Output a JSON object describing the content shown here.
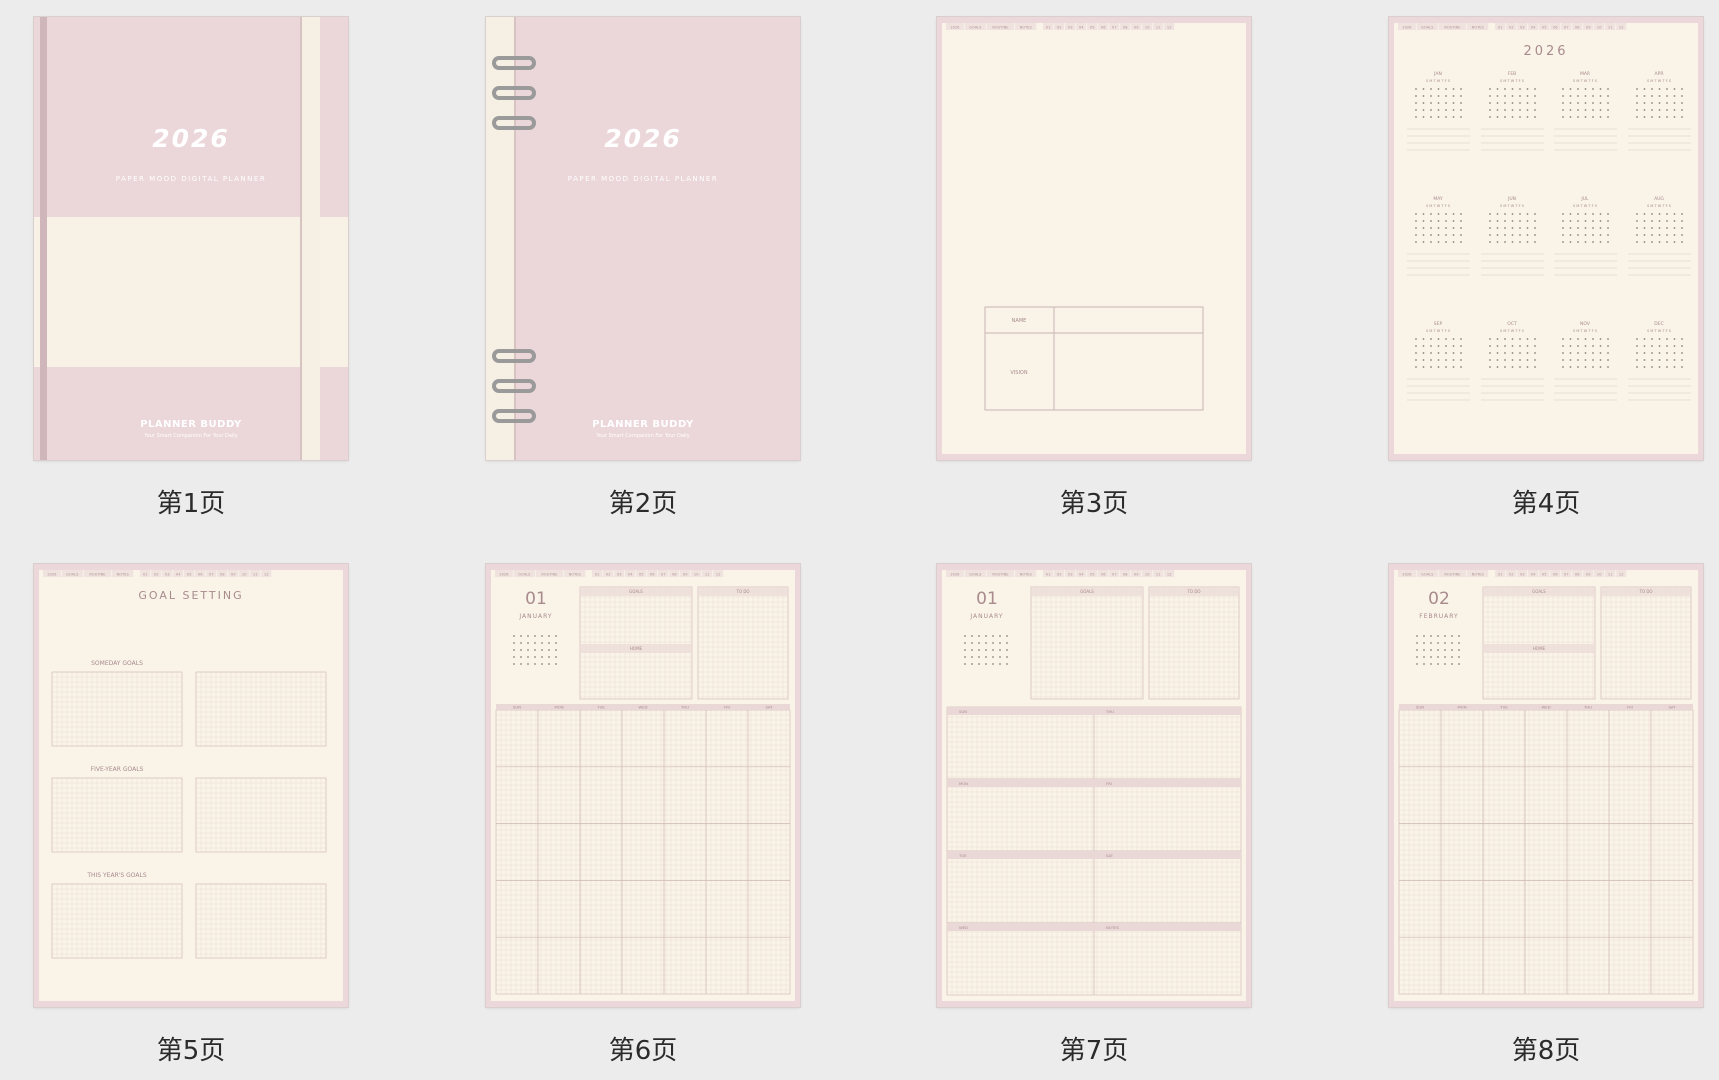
{
  "cover": {
    "year": "2026",
    "subtitle": "PAPER MOOD DIGITAL PLANNER",
    "brand": "PLANNER BUDDY",
    "tagline": "Your Smart Companion For Your Daily"
  },
  "tabs": [
    "2026",
    "GOALS",
    "ROUTINE",
    "NOTES",
    "01",
    "02",
    "03",
    "04",
    "05",
    "06",
    "07",
    "08",
    "09",
    "10",
    "11",
    "12"
  ],
  "name_page": {
    "name_label": "NAME",
    "vision_label": "VISION"
  },
  "year_page": {
    "year": "2026",
    "months": [
      "JAN",
      "FEB",
      "MAR",
      "APR",
      "MAY",
      "JUN",
      "JUL",
      "AUG",
      "SEP",
      "OCT",
      "NOV",
      "DEC"
    ],
    "weekday_letters": "S M T W T F S"
  },
  "goal_page": {
    "title": "GOAL SETTING",
    "sections": [
      "SOMEDAY GOALS",
      "FIVE-YEAR GOALS",
      "THIS YEAR'S GOALS"
    ]
  },
  "month_pages": [
    {
      "num": "01",
      "name": "JANUARY",
      "box1": "GOALS",
      "box2": "TO DO",
      "box3": "HOME"
    },
    {
      "num": "01",
      "name": "JANUARY",
      "box1": "GOALS",
      "box2": "TO DO"
    },
    {
      "num": "02",
      "name": "FEBRUARY",
      "box1": "GOALS",
      "box2": "TO DO",
      "box3": "HOME"
    }
  ],
  "weekdays": [
    "SUN",
    "MON",
    "TUE",
    "WED",
    "THU",
    "FRI",
    "SAT"
  ],
  "week_page": {
    "cells": [
      "SUN",
      "THU",
      "MON",
      "FRI",
      "TUE",
      "SAT",
      "WED",
      "NOTES"
    ]
  },
  "captions": [
    "第1页",
    "第2页",
    "第3页",
    "第4页",
    "第5页",
    "第6页",
    "第7页",
    "第8页"
  ],
  "colors": {
    "pink": "#ebd6da",
    "cream": "#f8f1e6",
    "accent_text": "#a98b8e",
    "grid_line": "#e9dcd0"
  }
}
